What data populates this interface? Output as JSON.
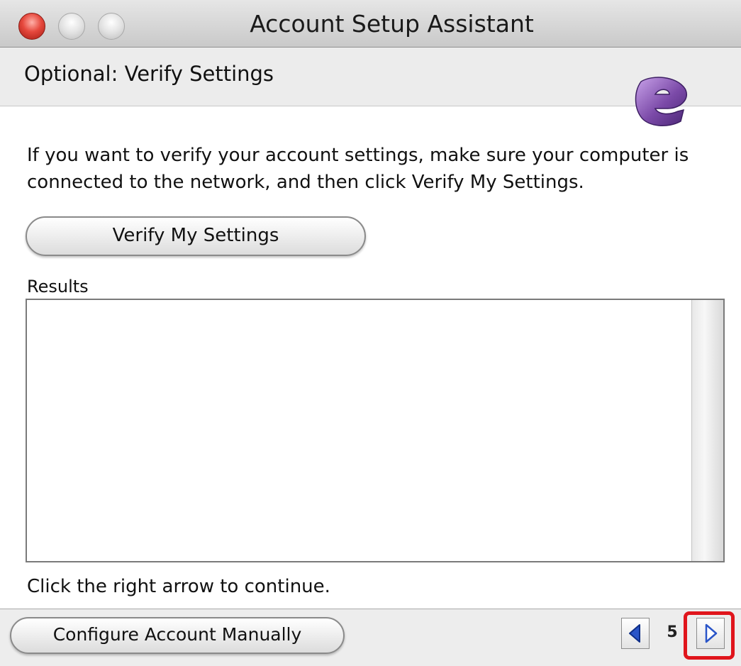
{
  "window": {
    "title": "Account Setup Assistant"
  },
  "header": {
    "title": "Optional: Verify Settings"
  },
  "body": {
    "instructions": "If you want to verify your account settings, make sure your computer is connected to the network, and then click Verify My Settings.",
    "verify_button_label": "Verify My Settings",
    "results_label": "Results",
    "results_text": "",
    "hint": "Click the right arrow to continue."
  },
  "footer": {
    "manual_button_label": "Configure Account Manually",
    "page_number": "5"
  },
  "icons": {
    "logo": "entourage-logo-icon",
    "prev": "left-arrow-icon",
    "next": "right-arrow-icon"
  },
  "colors": {
    "logo_purple": "#7b4aa8",
    "nav_arrow_blue": "#2a55c8",
    "highlight_red": "#e0151c"
  }
}
